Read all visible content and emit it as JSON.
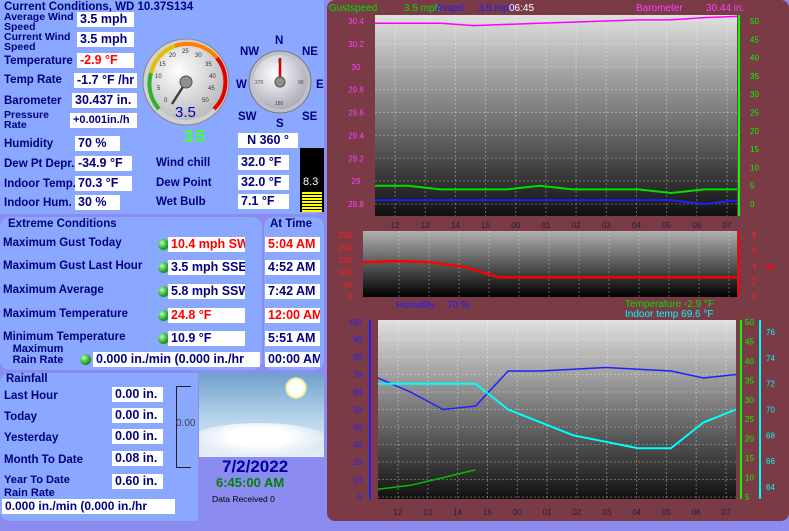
{
  "header": {
    "title": "Current Conditions, WD 10.37S134"
  },
  "current": {
    "avg_wind_label": "Average Wind Speed",
    "avg_wind_value": "3.5 mph",
    "cur_wind_label": "Current Wind Speed",
    "cur_wind_value": "3.5 mph",
    "temp_label": "Temperature",
    "temp_value": "-2.9 °F",
    "temp_rate_label": "Temp Rate",
    "temp_rate_value": "-1.7 °F /hr",
    "baro_label": "Barometer",
    "baro_value": "30.437 in.",
    "pres_rate_label": "Pressure Rate",
    "pres_rate_value": "+0.001in./h",
    "humidity_label": "Humidity",
    "humidity_value": "70 %",
    "dew_depr_label": "Dew Pt Depr.",
    "dew_depr_value": "-34.9 °F",
    "indoor_temp_label": "Indoor Temp.",
    "indoor_temp_value": "70.3 °F",
    "indoor_hum_label": "Indoor Hum.",
    "indoor_hum_value": "30 %",
    "wind_chill_label": "Wind chill",
    "wind_chill_value": "32.0 °F",
    "dew_point_label": "Dew Point",
    "dew_point_value": "32.0 °F",
    "wet_bulb_label": "Wet Bulb",
    "wet_bulb_value": "7.1 °F",
    "uv_value": "8.3",
    "wind_speed_gauge_value": "3.5",
    "wind_dir_value": "N  360 °",
    "wind_dir_digits": "35"
  },
  "compass": {
    "n": "N",
    "ne": "NE",
    "e": "E",
    "se": "SE",
    "s": "S",
    "sw": "SW",
    "w": "W",
    "nw": "NW"
  },
  "gauge_ticks": {
    "t0": "0",
    "t5": "5",
    "t10": "10",
    "t15": "15",
    "t20": "20",
    "t25": "25",
    "t30": "30",
    "t35": "35",
    "t40": "40",
    "t45": "45",
    "t50": "50"
  },
  "compass_ticks": {
    "c0": "0",
    "c90": "90",
    "c180": "180",
    "c270": "270"
  },
  "extremes": {
    "title": "Extreme Conditions",
    "at_time_title": "At Time",
    "rows": [
      {
        "label": "Maximum Gust Today",
        "value": "10.4 mph SW",
        "time": "5:04 AM",
        "red": true
      },
      {
        "label": "Maximum Gust Last Hour",
        "value": "3.5 mph SSE",
        "time": "4:52 AM",
        "red": false
      },
      {
        "label": "Maximum Average",
        "value": "5.8 mph SSW",
        "time": "7:42 AM",
        "red": false
      },
      {
        "label": "Maximum Temperature",
        "value": "24.8 °F",
        "time": "12:00 AM",
        "red": true
      },
      {
        "label": "Minimum Temperature",
        "value": "10.9 °F",
        "time": "5:51 AM",
        "red": false
      },
      {
        "label": "Maximum Rain Rate",
        "value": "0.000 in./min (0.000 in./hr",
        "time": "00:00 AM",
        "red": false
      }
    ]
  },
  "rainfall": {
    "title": "Rainfall",
    "last_hour_label": "Last Hour",
    "last_hour_value": "0.00 in.",
    "today_label": "Today",
    "today_value": "0.00 in.",
    "yesterday_label": "Yesterday",
    "yesterday_value": "0.00 in.",
    "mtd_label": "Month To Date",
    "mtd_value": "0.08 in.",
    "ytd_label": "Year To Date",
    "ytd_value": "0.60 in.",
    "rate_label": "Rain Rate",
    "rate_value": "0.000 in./min (0.000 in./hr",
    "gauge_value": "0.00"
  },
  "footer": {
    "date": "7/2/2022",
    "time": "6:45:00 AM",
    "received": "Data Received 0"
  },
  "graphs": {
    "top_header": {
      "gust": "Gustspeed",
      "gust_val": "3.5 mph",
      "avsp": "Avspd",
      "avsp_val": "3.5 mph",
      "clock": "06:45",
      "baro": "Barometer",
      "baro_val": "30.44 in."
    },
    "mid_header": {
      "humidity": "Humidity",
      "humidity_val": "70 %",
      "temp": "Temperature -2.9 °F",
      "indoor": "Indoor temp 69.6 °F"
    },
    "rain_units": "/hr",
    "xticks": [
      "12",
      "13",
      "14",
      "15",
      "00",
      "01",
      "02",
      "03",
      "04",
      "05",
      "06",
      "07"
    ]
  },
  "colors": {
    "gust": "#00e000",
    "avsp": "#2020ff",
    "baro": "#ff00ff",
    "rain": "#ff0000",
    "humidity": "#2020ff",
    "temp": "#00c000",
    "indoor": "#00ffff"
  },
  "chart_data": [
    {
      "type": "line",
      "title": "Wind and Barometer",
      "x": [
        "12",
        "13",
        "14",
        "15",
        "00",
        "01",
        "02",
        "03",
        "04",
        "05",
        "06",
        "07"
      ],
      "y_left_ticks": [
        "28.8",
        "29",
        "29.2",
        "29.4",
        "29.6",
        "29.8",
        "30",
        "30.2",
        "30.4"
      ],
      "y_right_ticks": [
        "0",
        "5",
        "10",
        "15",
        "20",
        "25",
        "30",
        "35",
        "40",
        "45",
        "50"
      ],
      "series": [
        {
          "name": "Gustspeed",
          "axis": "right",
          "values": [
            5,
            5,
            4,
            4,
            4,
            5,
            4,
            4,
            4,
            3,
            4,
            4
          ]
        },
        {
          "name": "Avspd",
          "axis": "right",
          "values": [
            1,
            1,
            1,
            1,
            1,
            1,
            1,
            1,
            1,
            1,
            0,
            1
          ]
        },
        {
          "name": "Barometer",
          "axis": "left",
          "values": [
            30.38,
            30.38,
            30.38,
            30.36,
            30.37,
            30.38,
            30.39,
            30.4,
            30.41,
            30.41,
            30.43,
            30.44
          ]
        }
      ]
    },
    {
      "type": "line",
      "title": "Rain rate",
      "y_left_ticks": [
        "0",
        "50",
        "100",
        "150",
        "200",
        "250"
      ],
      "y_right_ticks": [
        "0",
        "2",
        "4",
        "6",
        "8"
      ],
      "series": [
        {
          "name": "Rain rate",
          "values": [
            140,
            145,
            140,
            120,
            80,
            80,
            80,
            80,
            80,
            80,
            80,
            80
          ]
        }
      ]
    },
    {
      "type": "line",
      "title": "Humidity and Temperature",
      "x": [
        "12",
        "13",
        "14",
        "15",
        "00",
        "01",
        "02",
        "03",
        "04",
        "05",
        "06",
        "07"
      ],
      "y_left_ticks": [
        "0",
        "10",
        "20",
        "30",
        "40",
        "50",
        "60",
        "70",
        "80",
        "90",
        "100"
      ],
      "y_right_ticks": [
        "5",
        "10",
        "15",
        "20",
        "25",
        "30",
        "35",
        "40",
        "45",
        "50"
      ],
      "y_right2_ticks": [
        "64",
        "66",
        "68",
        "70",
        "72",
        "74",
        "76"
      ],
      "series": [
        {
          "name": "Humidity",
          "axis": "left",
          "values": [
            68,
            60,
            50,
            52,
            72,
            72,
            73,
            74,
            73,
            72,
            68,
            70
          ]
        },
        {
          "name": "Temperature",
          "axis": "right",
          "values": [
            7,
            8,
            10,
            12,
            null,
            null,
            null,
            null,
            null,
            null,
            null,
            null
          ]
        },
        {
          "name": "Indoor temp",
          "axis": "right2",
          "values": [
            72,
            72,
            72,
            72,
            70,
            69,
            68,
            67.5,
            67,
            67,
            69,
            70
          ]
        }
      ]
    }
  ]
}
